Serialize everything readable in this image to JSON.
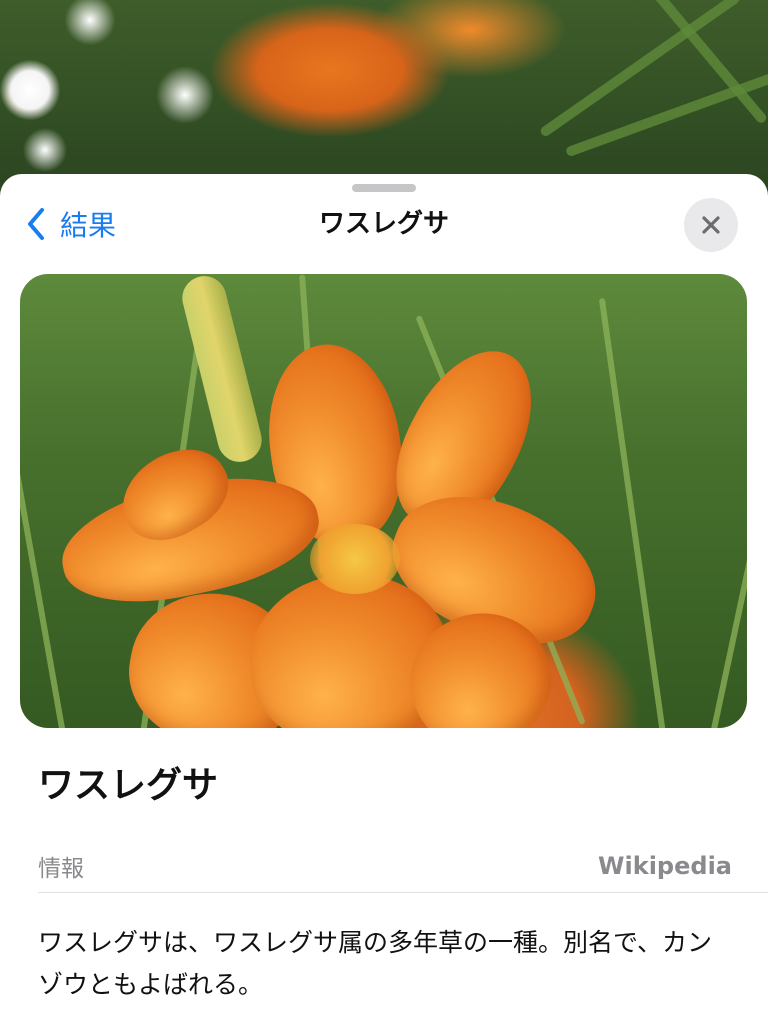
{
  "nav": {
    "back_label": "結果",
    "title": "ワスレグサ",
    "close_icon": "close-icon"
  },
  "hero": {
    "image_subject": "orange daylily flower"
  },
  "content": {
    "heading": "ワスレグサ",
    "info_label": "情報",
    "info_source": "Wikipedia",
    "description": "ワスレグサは、ワスレグサ属の多年草の一種。別名で、カンゾウともよばれる。"
  },
  "colors": {
    "accent": "#1a7cf0",
    "secondary_text": "#8a8a8e",
    "sheet_background": "#ffffff"
  }
}
